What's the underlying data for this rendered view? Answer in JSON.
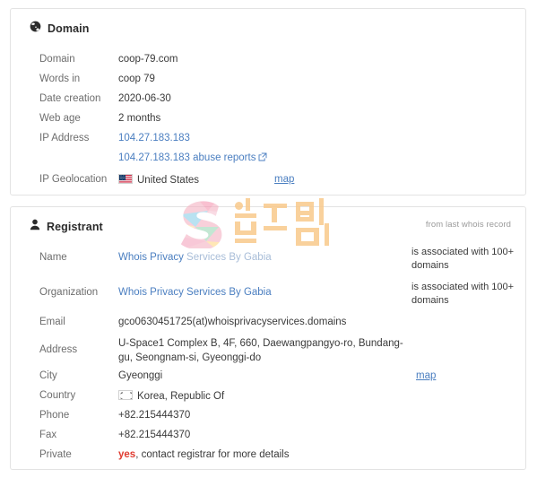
{
  "domain_panel": {
    "icon": "globe-icon",
    "title": "Domain",
    "rows": [
      {
        "label": "Domain",
        "value": "coop-79.com"
      },
      {
        "label": "Words in",
        "value": "coop 79"
      },
      {
        "label": "Date creation",
        "value": "2020-06-30"
      },
      {
        "label": "Web age",
        "value": "2 months"
      },
      {
        "label": "IP Address",
        "value": "104.27.183.183"
      }
    ],
    "ip_address_link": "104.27.183.183",
    "abuse_reports_link": "104.27.183.183 abuse reports",
    "abuse_reports_icon": "external-link-icon",
    "geolocation_label": "IP Geolocation",
    "geolocation_country": "United States",
    "geolocation_flag": "us-flag-icon",
    "geolocation_map_link": "map"
  },
  "registrant_panel": {
    "icon": "user-icon",
    "title": "Registrant",
    "note": "from last whois record",
    "name_label": "Name",
    "name_link_strong": "Whois Privacy",
    "name_link_faded": " Services By Gabia",
    "name_assoc": "is associated with 100+ domains",
    "organization_label": "Organization",
    "organization_link": "Whois Privacy Services By Gabia",
    "organization_assoc": "is associated with 100+ domains",
    "email_label": "Email",
    "email_value": "gco0630451725(at)whoisprivacyservices.domains",
    "address_label": "Address",
    "address_value": "U-Space1 Complex B, 4F, 660, Daewangpangyo-ro, Bundang-gu, Seongnam-si, Gyeonggi-do",
    "city_label": "City",
    "city_value": "Gyeonggi",
    "city_map_link": "map",
    "country_label": "Country",
    "country_value": "Korea, Republic Of",
    "country_flag": "kr-flag-icon",
    "phone_label": "Phone",
    "phone_value": "+82.215444370",
    "fax_label": "Fax",
    "fax_value": "+82.215444370",
    "private_label": "Private",
    "private_value_highlight": "yes",
    "private_value_rest": ", contact registrar for more details"
  },
  "watermark": {
    "logo": "shieldman-s-logo",
    "text": "쉴드맨"
  },
  "colors": {
    "link": "#4a7ec0",
    "link_faded": "#a8bdd8",
    "label": "#6d6d6d",
    "value": "#3a3a3a",
    "alert": "#e03c31",
    "panel_border": "#e3e3e3",
    "watermark": "#f9c98b"
  }
}
